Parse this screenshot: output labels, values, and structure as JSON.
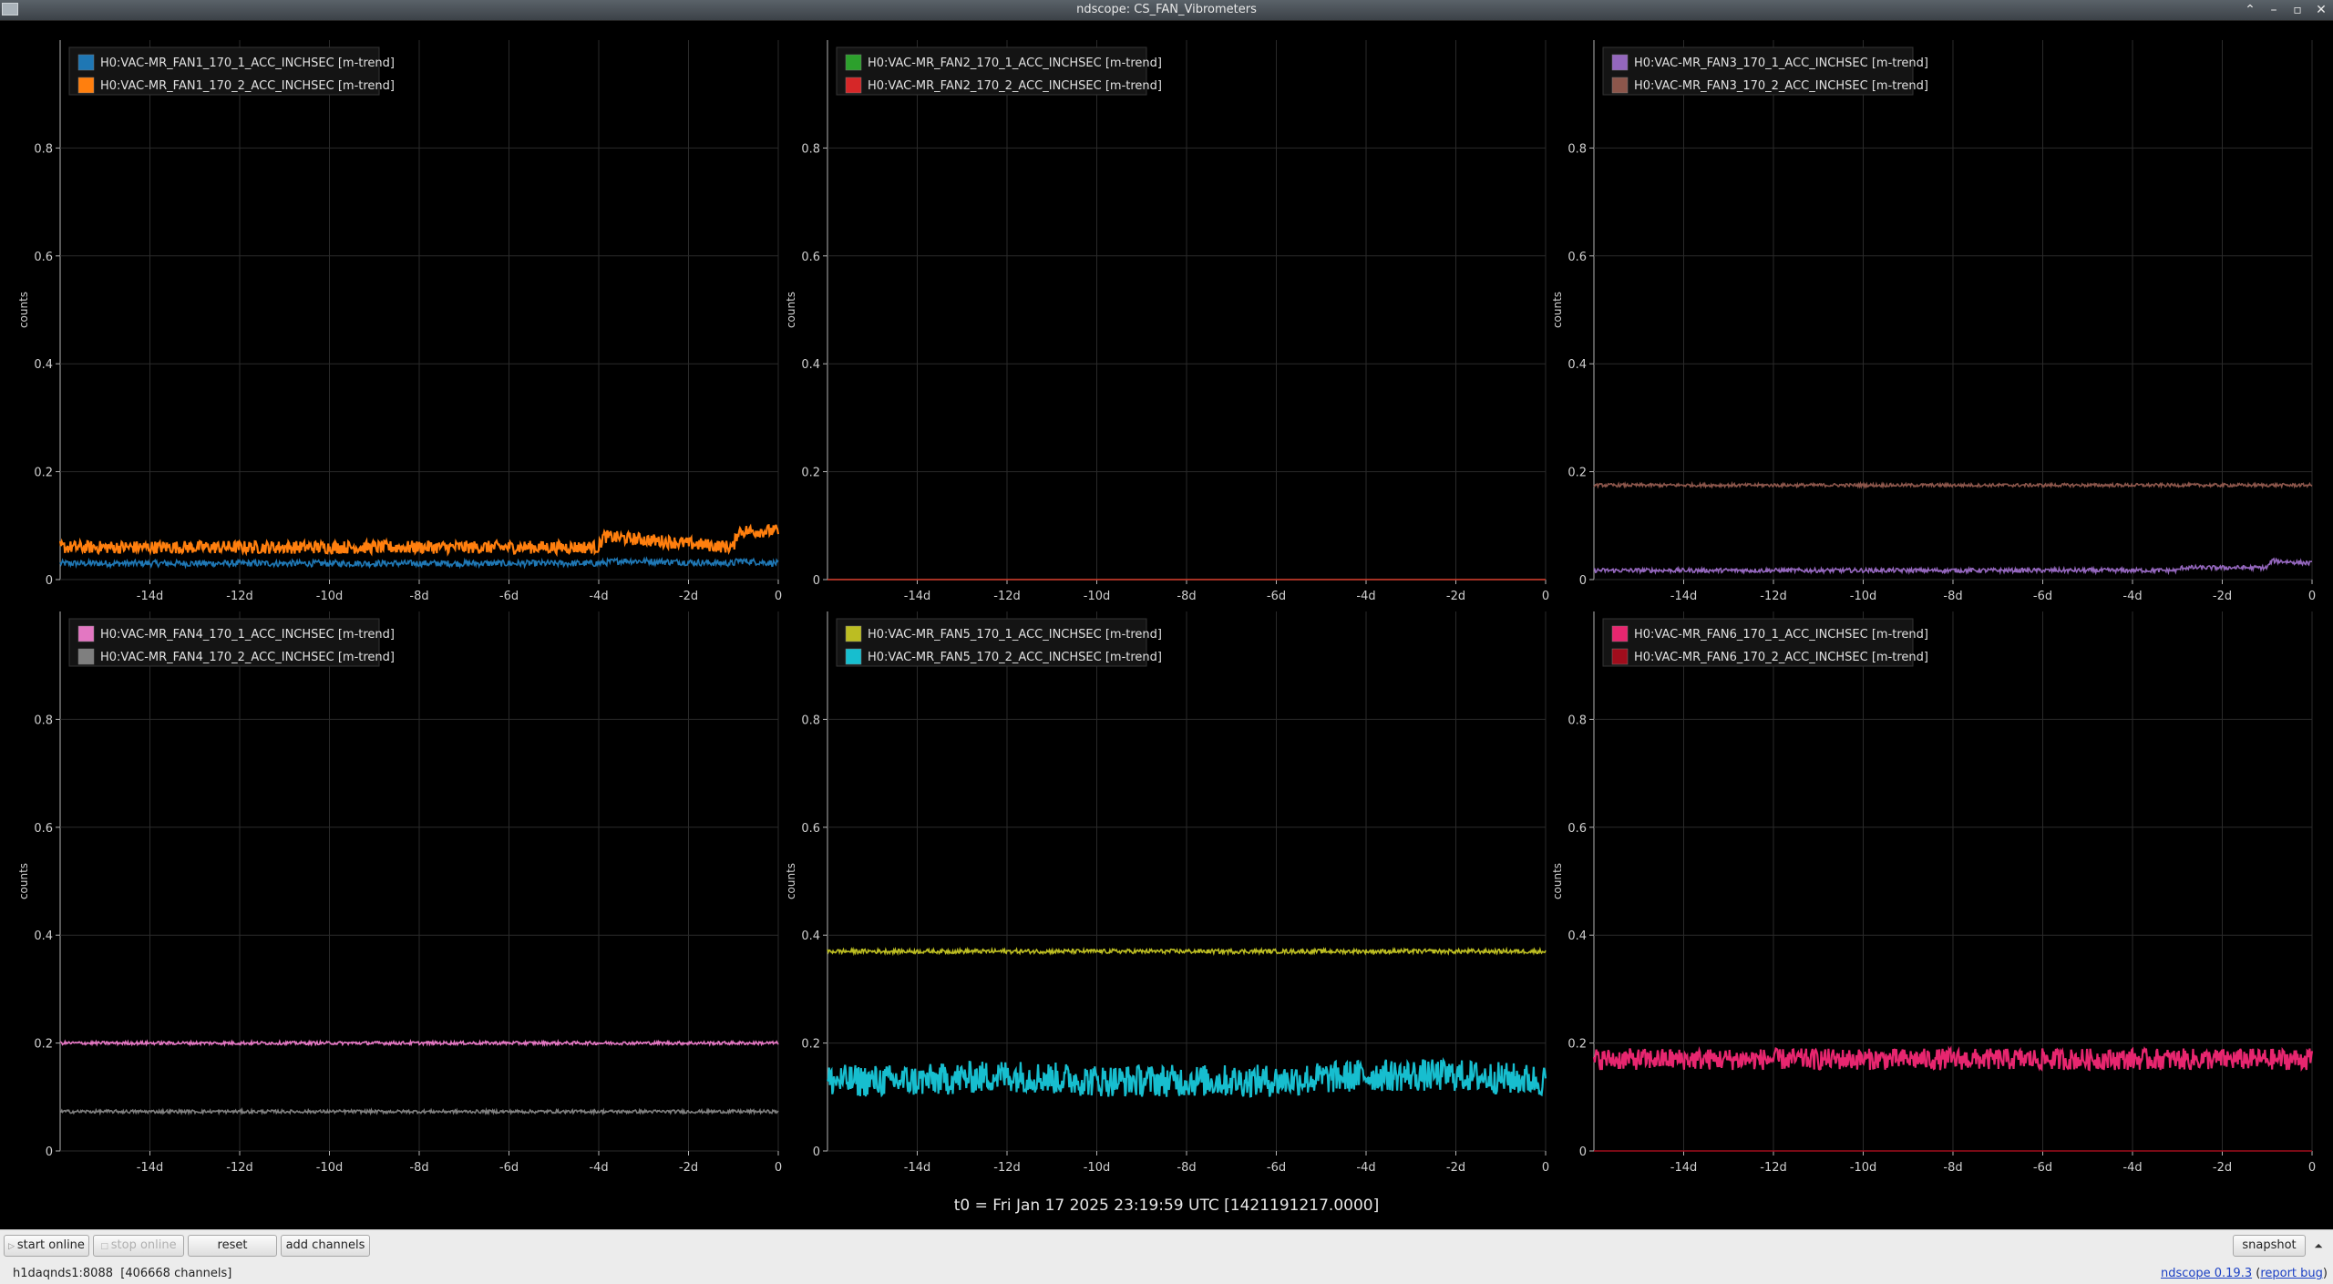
{
  "window": {
    "title": "ndscope: CS_FAN_Vibrometers",
    "controls": [
      "⌃",
      "–",
      "▫",
      "✕"
    ]
  },
  "plots": [
    {
      "ylabel": "counts",
      "yticks": [
        "0",
        "0.2",
        "0.4",
        "0.6",
        "0.8"
      ],
      "xticks": [
        "-14d",
        "-12d",
        "-10d",
        "-8d",
        "-6d",
        "-4d",
        "-2d",
        "0"
      ],
      "legend": [
        {
          "label": "H0:VAC-MR_FAN1_170_1_ACC_INCHSEC [m-trend]",
          "color": "#1f77b4"
        },
        {
          "label": "H0:VAC-MR_FAN1_170_2_ACC_INCHSEC [m-trend]",
          "color": "#ff7f0e"
        }
      ]
    },
    {
      "ylabel": "counts",
      "yticks": [
        "0",
        "0.2",
        "0.4",
        "0.6",
        "0.8"
      ],
      "xticks": [
        "-14d",
        "-12d",
        "-10d",
        "-8d",
        "-6d",
        "-4d",
        "-2d",
        "0"
      ],
      "legend": [
        {
          "label": "H0:VAC-MR_FAN2_170_1_ACC_INCHSEC [m-trend]",
          "color": "#2ca02c"
        },
        {
          "label": "H0:VAC-MR_FAN2_170_2_ACC_INCHSEC [m-trend]",
          "color": "#d62728"
        }
      ]
    },
    {
      "ylabel": "counts",
      "yticks": [
        "0",
        "0.2",
        "0.4",
        "0.6",
        "0.8"
      ],
      "xticks": [
        "-14d",
        "-12d",
        "-10d",
        "-8d",
        "-6d",
        "-4d",
        "-2d",
        "0"
      ],
      "legend": [
        {
          "label": "H0:VAC-MR_FAN3_170_1_ACC_INCHSEC [m-trend]",
          "color": "#9467bd"
        },
        {
          "label": "H0:VAC-MR_FAN3_170_2_ACC_INCHSEC [m-trend]",
          "color": "#8c564b"
        }
      ]
    },
    {
      "ylabel": "counts",
      "yticks": [
        "0",
        "0.2",
        "0.4",
        "0.6",
        "0.8"
      ],
      "xticks": [
        "-14d",
        "-12d",
        "-10d",
        "-8d",
        "-6d",
        "-4d",
        "-2d",
        "0"
      ],
      "legend": [
        {
          "label": "H0:VAC-MR_FAN4_170_1_ACC_INCHSEC [m-trend]",
          "color": "#e377c2"
        },
        {
          "label": "H0:VAC-MR_FAN4_170_2_ACC_INCHSEC [m-trend]",
          "color": "#7f7f7f"
        }
      ]
    },
    {
      "ylabel": "counts",
      "yticks": [
        "0",
        "0.2",
        "0.4",
        "0.6",
        "0.8"
      ],
      "xticks": [
        "-14d",
        "-12d",
        "-10d",
        "-8d",
        "-6d",
        "-4d",
        "-2d",
        "0"
      ],
      "legend": [
        {
          "label": "H0:VAC-MR_FAN5_170_1_ACC_INCHSEC [m-trend]",
          "color": "#bcbd22"
        },
        {
          "label": "H0:VAC-MR_FAN5_170_2_ACC_INCHSEC [m-trend]",
          "color": "#17becf"
        }
      ]
    },
    {
      "ylabel": "counts",
      "yticks": [
        "0",
        "0.2",
        "0.4",
        "0.6",
        "0.8"
      ],
      "xticks": [
        "-14d",
        "-12d",
        "-10d",
        "-8d",
        "-6d",
        "-4d",
        "-2d",
        "0"
      ],
      "legend": [
        {
          "label": "H0:VAC-MR_FAN6_170_1_ACC_INCHSEC [m-trend]",
          "color": "#e7266f"
        },
        {
          "label": "H0:VAC-MR_FAN6_170_2_ACC_INCHSEC [m-trend]",
          "color": "#a00d1c"
        }
      ]
    }
  ],
  "t0_label": "t0 = Fri Jan 17 2025 23:19:59 UTC [1421191217.0000]",
  "controls": {
    "start_online": "start online",
    "stop_online": "stop online",
    "reset": "reset",
    "add_channels": "add channels",
    "snapshot": "snapshot",
    "menu_arrow": "⏶"
  },
  "status": {
    "server": "h1daqnds1:8088",
    "channels": "[406668 channels]",
    "version_link": "ndscope 0.19.3",
    "report_bug": "report bug"
  },
  "chart_data": [
    {
      "type": "line",
      "ylabel": "counts",
      "ylim": [
        0,
        1
      ],
      "xlim": [
        -16,
        0
      ],
      "x_unit": "days",
      "series": [
        {
          "name": "H0:VAC-MR_FAN1_170_1_ACC_INCHSEC [m-trend]",
          "x": [
            -16,
            -4,
            -3.5,
            -1,
            -0.9,
            0
          ],
          "y": [
            0.03,
            0.03,
            0.035,
            0.03,
            0.035,
            0.03
          ]
        },
        {
          "name": "H0:VAC-MR_FAN1_170_2_ACC_INCHSEC [m-trend]",
          "x": [
            -16,
            -4,
            -3.9,
            -1,
            -0.9,
            0
          ],
          "y": [
            0.06,
            0.06,
            0.08,
            0.06,
            0.09,
            0.09
          ]
        }
      ]
    },
    {
      "type": "line",
      "ylabel": "counts",
      "ylim": [
        0,
        1
      ],
      "xlim": [
        -16,
        0
      ],
      "x_unit": "days",
      "series": [
        {
          "name": "H0:VAC-MR_FAN2_170_1_ACC_INCHSEC [m-trend]",
          "x": [
            -16,
            0
          ],
          "y": [
            0,
            0
          ]
        },
        {
          "name": "H0:VAC-MR_FAN2_170_2_ACC_INCHSEC [m-trend]",
          "x": [
            -16,
            0
          ],
          "y": [
            0,
            0
          ]
        }
      ]
    },
    {
      "type": "line",
      "ylabel": "counts",
      "ylim": [
        0,
        1
      ],
      "xlim": [
        -16,
        0
      ],
      "x_unit": "days",
      "series": [
        {
          "name": "H0:VAC-MR_FAN3_170_1_ACC_INCHSEC [m-trend]",
          "x": [
            -16,
            -3,
            -2.9,
            -1,
            -0.9,
            0
          ],
          "y": [
            0.017,
            0.017,
            0.022,
            0.022,
            0.035,
            0.03
          ]
        },
        {
          "name": "H0:VAC-MR_FAN3_170_2_ACC_INCHSEC [m-trend]",
          "x": [
            -16,
            0
          ],
          "y": [
            0.175,
            0.175
          ]
        }
      ]
    },
    {
      "type": "line",
      "ylabel": "counts",
      "ylim": [
        0,
        1
      ],
      "xlim": [
        -16,
        0
      ],
      "x_unit": "days",
      "series": [
        {
          "name": "H0:VAC-MR_FAN4_170_1_ACC_INCHSEC [m-trend]",
          "x": [
            -16,
            0
          ],
          "y": [
            0.2,
            0.2
          ]
        },
        {
          "name": "H0:VAC-MR_FAN4_170_2_ACC_INCHSEC [m-trend]",
          "x": [
            -16,
            0
          ],
          "y": [
            0.073,
            0.073
          ]
        }
      ]
    },
    {
      "type": "line",
      "ylabel": "counts",
      "ylim": [
        0,
        1
      ],
      "xlim": [
        -16,
        0
      ],
      "x_unit": "days",
      "series": [
        {
          "name": "H0:VAC-MR_FAN5_170_1_ACC_INCHSEC [m-trend]",
          "x": [
            -16,
            0
          ],
          "y": [
            0.37,
            0.37
          ]
        },
        {
          "name": "H0:VAC-MR_FAN5_170_2_ACC_INCHSEC [m-trend]",
          "x": [
            -16,
            -14,
            -12,
            -10,
            -8,
            -6,
            -4,
            -2,
            0
          ],
          "y": [
            0.13,
            0.13,
            0.14,
            0.13,
            0.13,
            0.13,
            0.14,
            0.14,
            0.13
          ]
        }
      ]
    },
    {
      "type": "line",
      "ylabel": "counts",
      "ylim": [
        0,
        1
      ],
      "xlim": [
        -16,
        0
      ],
      "x_unit": "days",
      "series": [
        {
          "name": "H0:VAC-MR_FAN6_170_1_ACC_INCHSEC [m-trend]",
          "x": [
            -16,
            0
          ],
          "y": [
            0.17,
            0.17
          ]
        },
        {
          "name": "H0:VAC-MR_FAN6_170_2_ACC_INCHSEC [m-trend]",
          "x": [
            -16,
            0
          ],
          "y": [
            0,
            0
          ]
        }
      ]
    }
  ]
}
